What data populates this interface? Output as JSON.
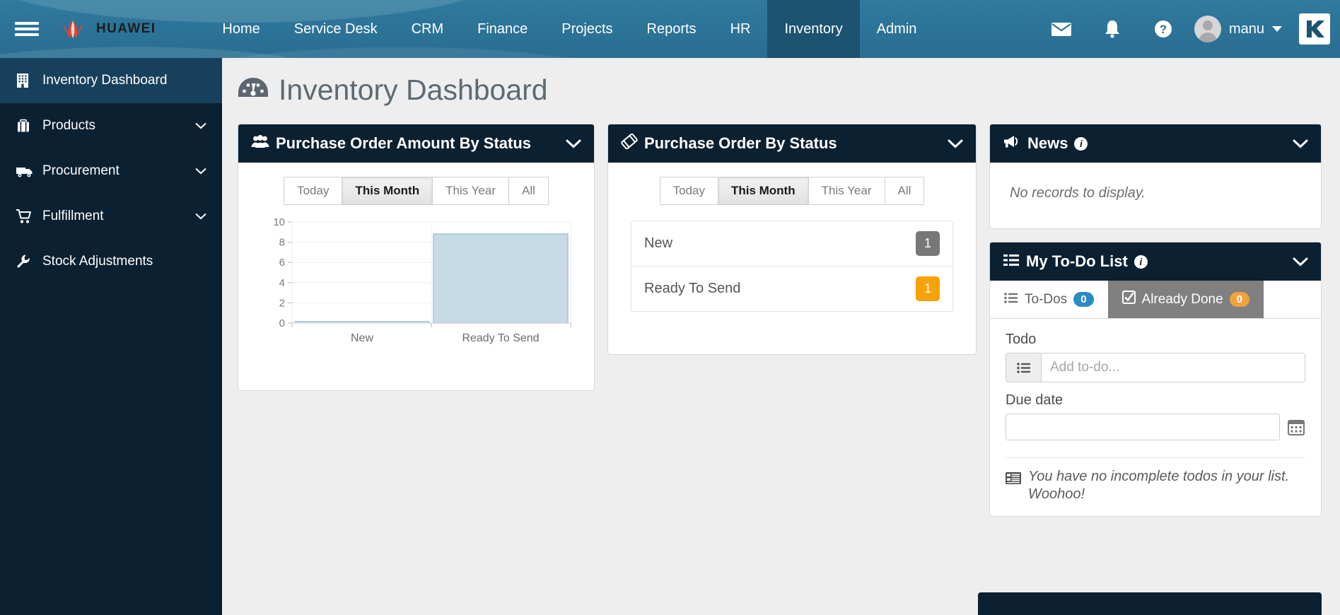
{
  "header": {
    "brand": "HUAWEI",
    "menu_icon": "hamburger-icon",
    "nav": [
      {
        "label": "Home",
        "active": false
      },
      {
        "label": "Service Desk",
        "active": false
      },
      {
        "label": "CRM",
        "active": false
      },
      {
        "label": "Finance",
        "active": false
      },
      {
        "label": "Projects",
        "active": false
      },
      {
        "label": "Reports",
        "active": false
      },
      {
        "label": "HR",
        "active": false
      },
      {
        "label": "Inventory",
        "active": true
      },
      {
        "label": "Admin",
        "active": false
      }
    ],
    "icons": [
      "envelope-icon",
      "bell-icon",
      "question-circle-icon"
    ],
    "username": "manu",
    "app_logo": "K"
  },
  "sidebar": {
    "items": [
      {
        "label": "Inventory Dashboard",
        "icon": "building-icon",
        "active": true,
        "expandable": false
      },
      {
        "label": "Products",
        "icon": "briefcase-icon",
        "active": false,
        "expandable": true
      },
      {
        "label": "Procurement",
        "icon": "truck-icon",
        "active": false,
        "expandable": true
      },
      {
        "label": "Fulfillment",
        "icon": "shopping-cart-icon",
        "active": false,
        "expandable": true
      },
      {
        "label": "Stock Adjustments",
        "icon": "wrench-icon",
        "active": false,
        "expandable": false
      }
    ]
  },
  "page": {
    "title": "Inventory Dashboard",
    "title_icon": "tachometer-icon"
  },
  "widgets": {
    "po_amount": {
      "title": "Purchase Order Amount By Status",
      "icon": "users-icon",
      "range_options": [
        "Today",
        "This Month",
        "This Year",
        "All"
      ],
      "range_selected": "This Month"
    },
    "po_status": {
      "title": "Purchase Order By Status",
      "icon": "tag-icon",
      "range_options": [
        "Today",
        "This Month",
        "This Year",
        "All"
      ],
      "range_selected": "This Month",
      "rows": [
        {
          "label": "New",
          "count": "1",
          "badge_color": "gray"
        },
        {
          "label": "Ready To Send",
          "count": "1",
          "badge_color": "orange"
        }
      ]
    },
    "news": {
      "title": "News",
      "icon": "bullhorn-icon",
      "empty_text": "No records to display."
    },
    "todo": {
      "title": "My To-Do List",
      "icon": "list-icon",
      "tabs": [
        {
          "label": "To-Dos",
          "count": "0",
          "icon": "list-ul-icon",
          "active": true,
          "pill_color": "blue"
        },
        {
          "label": "Already Done",
          "count": "0",
          "icon": "check-square-icon",
          "active": false,
          "pill_color": "orange"
        }
      ],
      "todo_label": "Todo",
      "todo_placeholder": "Add to-do...",
      "todo_value": "",
      "due_label": "Due date",
      "due_value": "",
      "empty_text": "You have no incomplete todos in your list. Woohoo!"
    }
  },
  "colors": {
    "header_blue": "#2b7296",
    "nav_active": "#1b5371",
    "sidebar_dark": "#0b2031",
    "sidebar_active": "#17405c",
    "panel_header": "#0b2031",
    "badge_gray": "#777777",
    "badge_orange": "#f7a209",
    "pill_blue": "#2b8bc4",
    "pill_orange": "#efa33c",
    "bar_fill": "#c7dbe6",
    "bar_stroke": "#9cc2d6"
  },
  "chart_data": {
    "type": "bar",
    "title": "Purchase Order Amount By Status",
    "categories": [
      "New",
      "Ready To Send"
    ],
    "values": [
      0.05,
      8.8
    ],
    "xlabel": "",
    "ylabel": "",
    "ylim": [
      0,
      10
    ],
    "yticks": [
      0,
      2,
      4,
      6,
      8,
      10
    ],
    "grid": true,
    "legend": false
  }
}
